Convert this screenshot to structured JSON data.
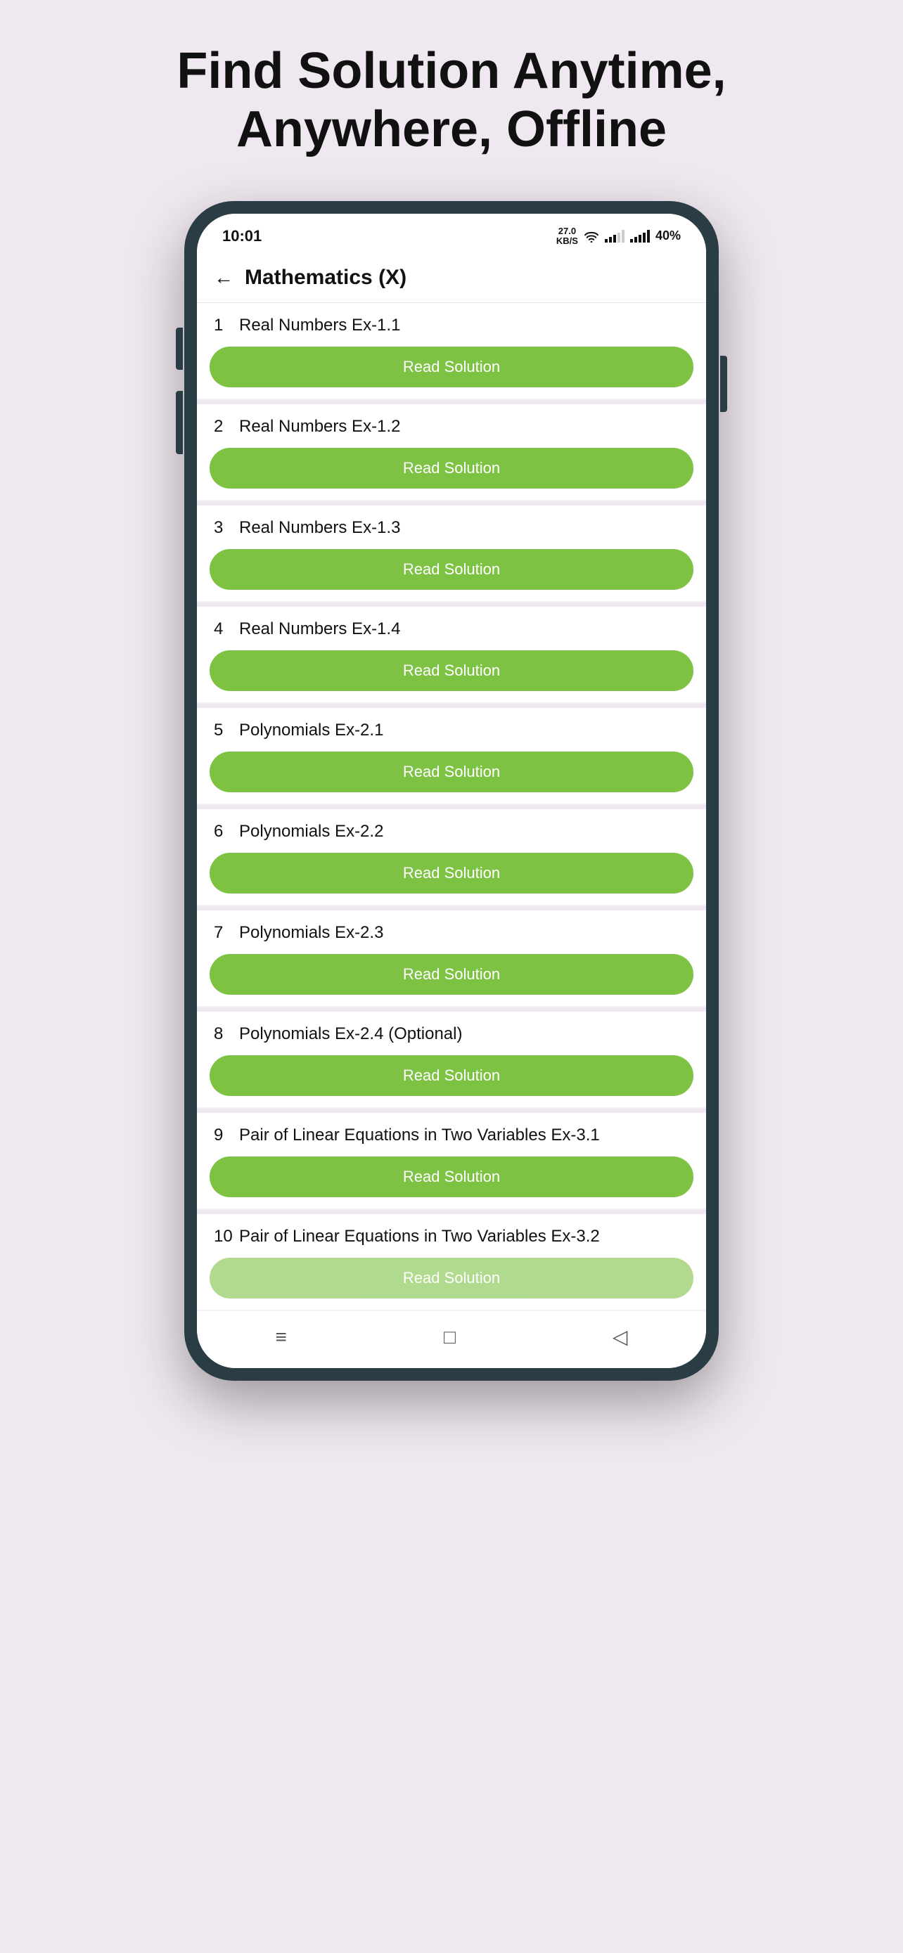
{
  "headline": "Find Solution Anytime, Anywhere, Offline",
  "status_bar": {
    "time": "10:01",
    "kb_s": "27.0\nKB/S",
    "battery": "40%"
  },
  "nav": {
    "title": "Mathematics (X)",
    "back_label": "←"
  },
  "items": [
    {
      "number": "1",
      "title": "Real Numbers Ex-1.1",
      "btn": "Read Solution"
    },
    {
      "number": "2",
      "title": "Real Numbers Ex-1.2",
      "btn": "Read Solution"
    },
    {
      "number": "3",
      "title": "Real Numbers Ex-1.3",
      "btn": "Read Solution"
    },
    {
      "number": "4",
      "title": "Real Numbers Ex-1.4",
      "btn": "Read Solution"
    },
    {
      "number": "5",
      "title": "Polynomials Ex-2.1",
      "btn": "Read Solution"
    },
    {
      "number": "6",
      "title": "Polynomials Ex-2.2",
      "btn": "Read Solution"
    },
    {
      "number": "7",
      "title": "Polynomials Ex-2.3",
      "btn": "Read Solution"
    },
    {
      "number": "8",
      "title": "Polynomials Ex-2.4 (Optional)",
      "btn": "Read Solution"
    },
    {
      "number": "9",
      "title": "Pair of Linear Equations in Two Variables Ex-3.1",
      "btn": "Read Solution"
    },
    {
      "number": "10",
      "title": "Pair of Linear Equations in Two Variables Ex-3.2",
      "btn": "Read Solution"
    }
  ],
  "bottom_nav": {
    "menu_icon": "≡",
    "home_icon": "□",
    "back_icon": "◁"
  },
  "colors": {
    "btn_green": "#7dc242",
    "bg_lavender": "#f0e8f0",
    "phone_dark": "#2a3d45"
  }
}
